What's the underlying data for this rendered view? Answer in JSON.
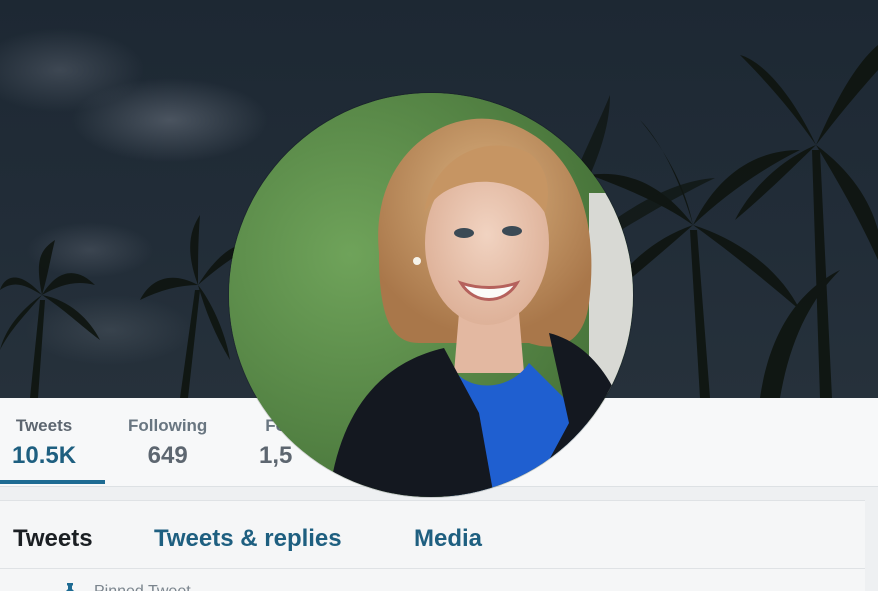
{
  "profile": {
    "avatar_alt": "Profile photo",
    "colors": {
      "accent": "#1e6b93",
      "tab_text": "#1e5f80",
      "active_tab_text": "#1b1f23",
      "stat_value_active": "#1e5f80"
    }
  },
  "stats": [
    {
      "label": "Tweets",
      "value": "10.5K",
      "active": true
    },
    {
      "label": "Following",
      "value": "649",
      "active": false
    },
    {
      "label": "Fo",
      "value": "1,5",
      "active": false
    }
  ],
  "tabs": [
    {
      "label": "Tweets",
      "active": true
    },
    {
      "label": "Tweets & replies",
      "active": false
    },
    {
      "label": "Media",
      "active": false
    }
  ],
  "pinned": {
    "label": "Pinned Tweet",
    "icon": "pin-icon"
  }
}
